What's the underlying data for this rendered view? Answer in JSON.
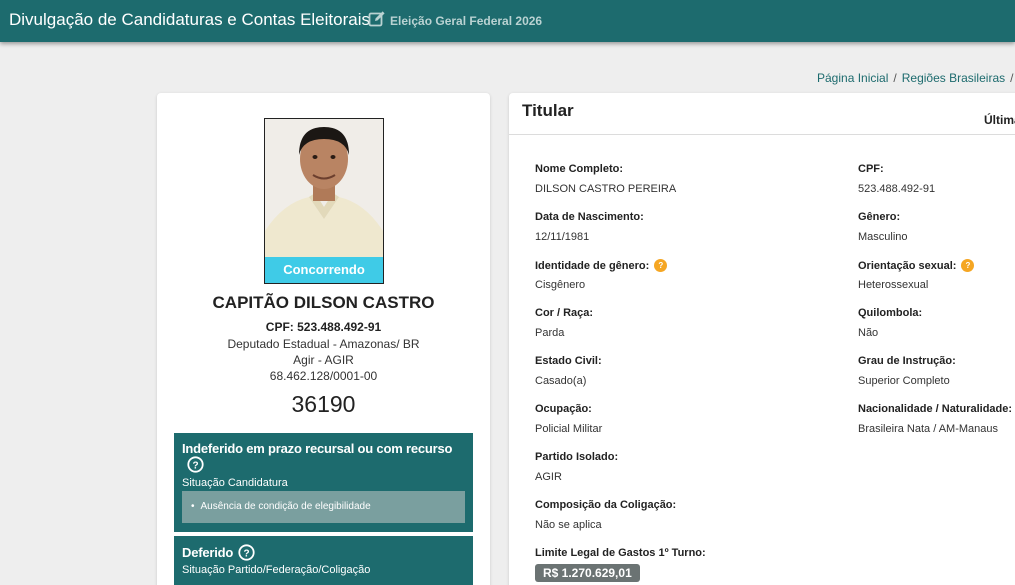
{
  "header": {
    "title": "Divulgação de Candidaturas e Contas Eleitorais",
    "election": "Eleição Geral Federal 2026",
    "edit_icon": "edit-icon"
  },
  "breadcrumb": {
    "home": "Página Inicial",
    "regions": "Regiões Brasileiras",
    "separator": "/"
  },
  "candidate": {
    "status": "Concorrendo",
    "name": "CAPITÃO DILSON CASTRO",
    "cpf": "CPF: 523.488.492-91",
    "office": "Deputado Estadual - Amazonas/ BR",
    "party": "Agir - AGIR",
    "cnpj": "68.462.128/0001-00",
    "number": "36190"
  },
  "status_boxes": {
    "candidacy": {
      "title": "Indeferido em prazo recursal ou com recurso",
      "subtitle": "Situação Candidatura",
      "reason": "Ausência de condição de elegibilidade"
    },
    "party": {
      "title": "Deferido",
      "subtitle": "Situação Partido/Federação/Coligação"
    }
  },
  "details": {
    "section_title": "Titular",
    "updated_label": "Última",
    "info_icon": "?",
    "full_name": {
      "label": "Nome Completo:",
      "value": "DILSON CASTRO PEREIRA"
    },
    "cpf": {
      "label": "CPF:",
      "value": "523.488.492-91"
    },
    "birth_date": {
      "label": "Data de Nascimento:",
      "value": "12/11/1981"
    },
    "gender": {
      "label": "Gênero:",
      "value": "Masculino"
    },
    "gender_identity": {
      "label": "Identidade de gênero:",
      "value": "Cisgênero"
    },
    "sexual_orientation": {
      "label": "Orientação sexual:",
      "value": "Heterossexual"
    },
    "race": {
      "label": "Cor / Raça:",
      "value": "Parda"
    },
    "quilombola": {
      "label": "Quilombola:",
      "value": "Não"
    },
    "civil_status": {
      "label": "Estado Civil:",
      "value": "Casado(a)"
    },
    "education": {
      "label": "Grau de Instrução:",
      "value": "Superior Completo"
    },
    "occupation": {
      "label": "Ocupação:",
      "value": "Policial Militar"
    },
    "nationality": {
      "label": "Nacionalidade / Naturalidade:",
      "value": "Brasileira Nata / AM-Manaus"
    },
    "isolated_party": {
      "label": "Partido Isolado:",
      "value": "AGIR"
    },
    "coalition": {
      "label": "Composição da Coligação:",
      "value": "Não se aplica"
    },
    "spending_limit": {
      "label": "Limite Legal de Gastos 1º Turno:",
      "value": "R$ 1.270.629,01"
    }
  },
  "colors": {
    "header_bg": "#1d6b6e",
    "status_banner": "#3fcbe7",
    "info_dot": "#f5a623",
    "money_badge": "#6b7373"
  }
}
